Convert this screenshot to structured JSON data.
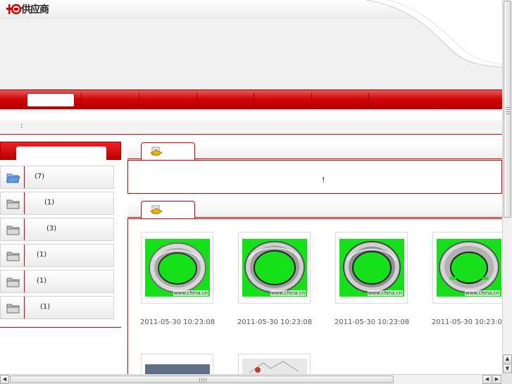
{
  "header": {
    "logo_text": "供应商",
    "logo_mark": "中国"
  },
  "nav": {
    "home_label": "",
    "items": [
      "",
      "",
      "",
      "",
      "",
      ""
    ]
  },
  "breadcrumb": {
    "text": ":"
  },
  "sidebar": {
    "title": "",
    "categories": [
      {
        "label": "(7)",
        "icon": "open-folder-icon"
      },
      {
        "label": "(1)",
        "icon": "folder-icon"
      },
      {
        "label": "(3)",
        "icon": "folder-icon"
      },
      {
        "label": "(1)",
        "icon": "folder-icon"
      },
      {
        "label": "(1)",
        "icon": "folder-icon"
      },
      {
        "label": "(1)",
        "icon": "folder-icon"
      }
    ]
  },
  "notice": {
    "tab_label": "",
    "text": "!"
  },
  "products": {
    "tab_label": "",
    "items": [
      {
        "date": "2011-05-30 10:23:08",
        "watermark": "www.china.cn"
      },
      {
        "date": "2011-05-30 10:23:08",
        "watermark": "www.china.cn"
      },
      {
        "date": "2011-05-30 10:23:08",
        "watermark": "www.china.cn"
      },
      {
        "date": "2011-05-30 10:23:08",
        "watermark": "www.china.cn"
      }
    ]
  },
  "colors": {
    "brand_red": "#cc0000",
    "product_bg": "#16e01a"
  }
}
